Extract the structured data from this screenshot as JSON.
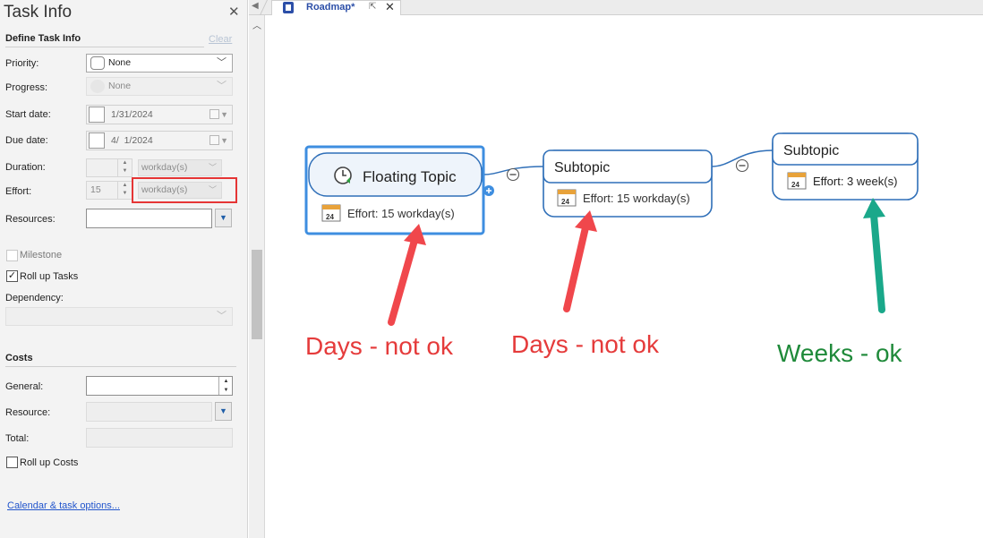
{
  "panel": {
    "title": "Task Info",
    "close_icon": "close-icon",
    "define_heading": "Define Task Info",
    "clear_label": "Clear",
    "priority": {
      "label": "Priority:",
      "value": "None"
    },
    "progress": {
      "label": "Progress:",
      "value": "None"
    },
    "start_date": {
      "label": "Start date:",
      "value": "1/31/2024"
    },
    "due_date": {
      "label": "Due date:",
      "value": "4/  1/2024"
    },
    "duration": {
      "label": "Duration:",
      "unit": "workday(s)"
    },
    "effort": {
      "label": "Effort:",
      "value": "15",
      "unit": "workday(s)"
    },
    "resources": {
      "label": "Resources:"
    },
    "milestone_label": "Milestone",
    "rollup_tasks": {
      "label": "Roll up Tasks",
      "checked": true
    },
    "dependency_label": "Dependency:",
    "costs_heading": "Costs",
    "general_label": "General:",
    "resource_label": "Resource:",
    "total_label": "Total:",
    "rollup_costs_label": "Roll up Costs",
    "calendar_link": "Calendar & task options..."
  },
  "tabs": [
    {
      "label": "Roadmap*",
      "icon": "map-document-icon",
      "active": true
    }
  ],
  "map": {
    "floating": {
      "title": "Floating Topic",
      "effort": "Effort: 15 workday(s)",
      "icon": "clock-progress-icon",
      "badge_icon": "calendar-24-icon"
    },
    "sub1": {
      "title": "Subtopic",
      "effort": "Effort: 15 workday(s)",
      "icon": "calendar-24-icon"
    },
    "sub2": {
      "title": "Subtopic",
      "effort": "Effort: 3 week(s)",
      "icon": "calendar-24-icon"
    },
    "calendar_day": "24",
    "annotations": [
      {
        "text": "Days - not ok",
        "color": "#e53b3b"
      },
      {
        "text": "Days - not ok",
        "color": "#e53b3b"
      },
      {
        "text": "Weeks - ok",
        "color": "#1f8a3a"
      }
    ],
    "arrow_colors": {
      "bad": "#f0474c",
      "good": "#1aa88a"
    }
  }
}
